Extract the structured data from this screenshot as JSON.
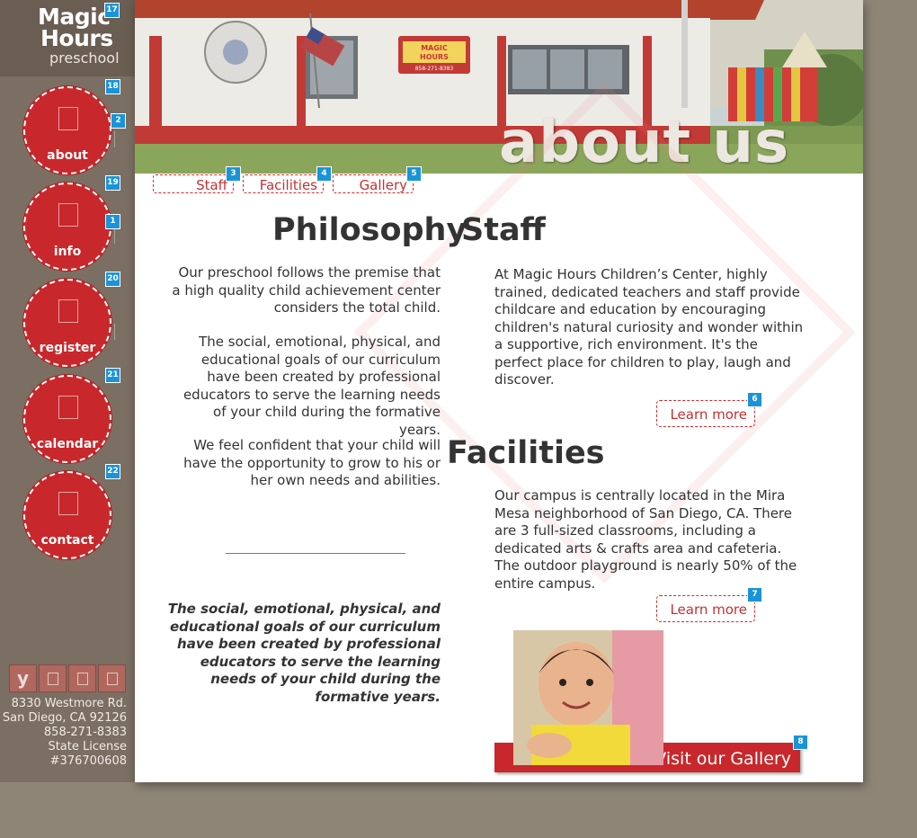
{
  "logo": {
    "line1": "Magic",
    "line2": "Hours",
    "line3": "preschool"
  },
  "nav": [
    {
      "label": "about",
      "badge": "18",
      "icon_badge": "2"
    },
    {
      "label": "info",
      "badge": "19",
      "icon_badge": "1"
    },
    {
      "label": "register",
      "badge": "20"
    },
    {
      "label": "calendar",
      "badge": "21"
    },
    {
      "label": "contact",
      "badge": "22"
    }
  ],
  "logo_badge": "17",
  "social": [
    {
      "label": "y",
      "icon": "youtube-icon"
    },
    {
      "label": "",
      "icon": "facebook-icon"
    },
    {
      "label": "",
      "icon": "twitter-icon"
    },
    {
      "label": "",
      "icon": "social-icon"
    }
  ],
  "address": {
    "street": "8330 Westmore Rd.",
    "city": "San Diego, CA 92126",
    "phone": "858-271-8383",
    "license_label": "State License",
    "license_number": "#376700608"
  },
  "hero": {
    "title": "about us",
    "sign_line1": "MAGIC",
    "sign_line2": "HOURS",
    "sign_phone": "858-271-8383"
  },
  "tabs": [
    {
      "label": "Staff",
      "badge": "3"
    },
    {
      "label": "Facilities",
      "badge": "4"
    },
    {
      "label": "Gallery",
      "badge": "5"
    }
  ],
  "philosophy": {
    "heading": "Philosophy",
    "p1": "Our preschool follows the premise that a high quality child achievement center considers the total child.",
    "p2": "The social, emotional, physical, and educational goals of our curriculum have been created by professional educators to serve the learning needs of your child during the formative years.",
    "p3": "We feel confident that your child will have the opportunity to grow to his or her own needs and abilities.",
    "quote": "The social, emotional, physical, and educational goals of our curriculum have been created by professional educators to serve the learning needs of your child during the formative years."
  },
  "staff": {
    "heading": "Staff",
    "text": "At Magic Hours Children’s Center, highly trained, dedicated teachers and staff provide childcare and education by encouraging children's natural curiosity and wonder within a supportive, rich environment. It's the perfect place for children to play, laugh and discover.",
    "learn_more": "Learn more",
    "badge": "6"
  },
  "facilities": {
    "heading": "Facilities",
    "text": "Our campus is centrally located in the Mira Mesa neighborhood of San Diego, CA.  There are 3 full-sized classrooms, including a dedicated arts & crafts area and cafeteria. The outdoor playground is nearly 50% of the entire campus.",
    "learn_more": "Learn more",
    "badge": "7"
  },
  "gallery": {
    "button": "Visit our Gallery",
    "badge": "8"
  },
  "colors": {
    "brand_red": "#c8282b",
    "sidebar": "#7b6e62",
    "badge_blue": "#1a94d8"
  }
}
